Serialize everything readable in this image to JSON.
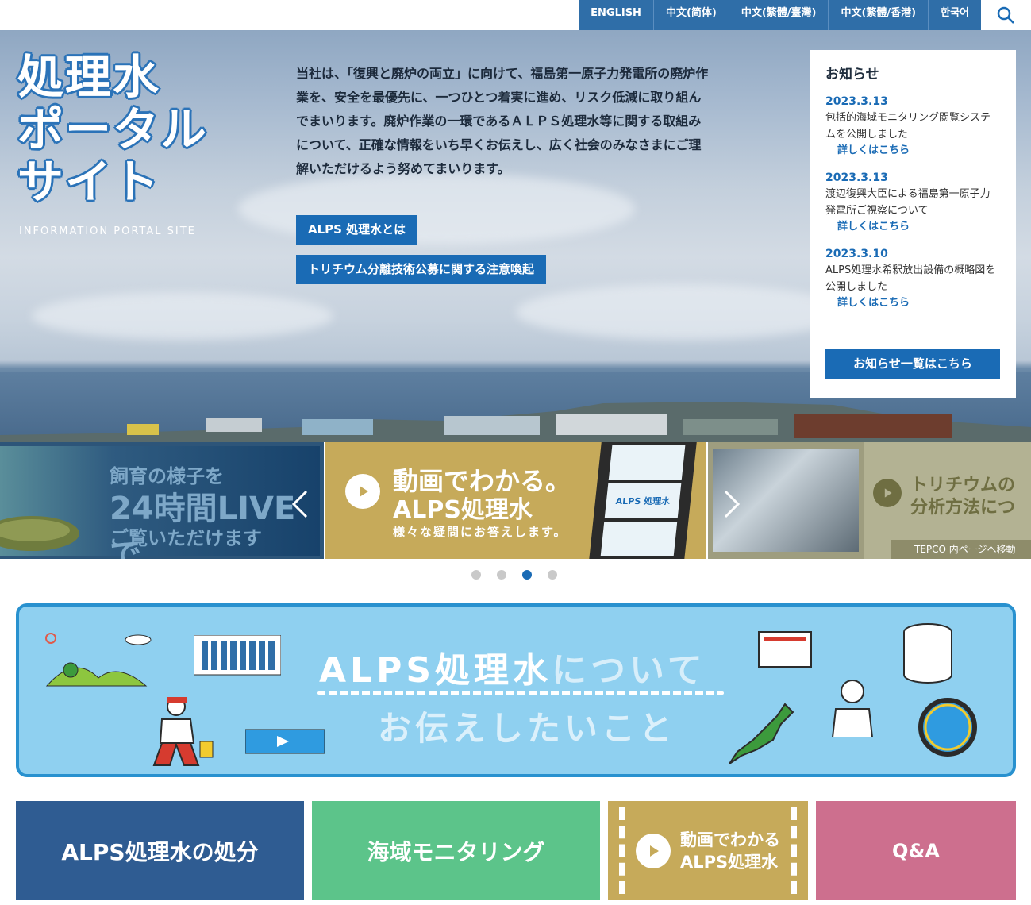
{
  "languages": [
    "ENGLISH",
    "中文(简体)",
    "中文(繁體/臺灣)",
    "中文(繁體/香港)",
    "한국어"
  ],
  "hero": {
    "title_lines": [
      "処理水",
      "ポータル",
      "サイト"
    ],
    "subtitle": "INFORMATION PORTAL SITE",
    "intro": "当社は、「復興と廃炉の両立」に向けて、福島第一原子力発電所の廃炉作業を、安全を最優先に、一つひとつ着実に進め、リスク低減に取り組んでまいります。廃炉作業の一環であるＡＬＰＳ処理水等に関する取組みについて、正確な情報をいち早くお伝えし、広く社会のみなさまにご理解いただけるよう努めてまいります。",
    "button1": "ALPS 処理水とは",
    "button2": "トリチウム分離技術公募に関する注意喚起"
  },
  "news": {
    "heading": "お知らせ",
    "items": [
      {
        "date": "2023.3.13",
        "text": "包括的海域モニタリング閲覧システムを公開しました",
        "more": "詳しくはこちら"
      },
      {
        "date": "2023.3.13",
        "text": "渡辺復興大臣による福島第一原子力発電所ご視察について",
        "more": "詳しくはこちら"
      },
      {
        "date": "2023.3.10",
        "text": "ALPS処理水希釈放出設備の概略図を公開しました",
        "more": "詳しくはこちら"
      }
    ],
    "all_button": "お知らせ一覧はこちら"
  },
  "carousel": {
    "slide_live": {
      "line1": "飼育の様子を",
      "line2": "24時間LIVEで",
      "line3": "ご覧いただけます"
    },
    "slide_video": {
      "line1": "動画でわかる。",
      "line2": "ALPS処理水",
      "line3": "様々な疑問にお答えします。",
      "film_label": "ALPS 処理水"
    },
    "slide_tritium": {
      "line1": "トリチウムの",
      "line2": "分析方法につ",
      "footer": "TEPCO 内ページへ移動"
    },
    "active_index": 2,
    "dot_count": 4
  },
  "banner": {
    "line1_main": "ALPS処理水",
    "line1_rest": "について",
    "line2": "お伝えしたいこと"
  },
  "tiles": {
    "disposal": "ALPS処理水の処分",
    "monitoring": "海域モニタリング",
    "video_line1": "動画でわかる",
    "video_line2": "ALPS処理水",
    "qa": "Q&A"
  },
  "colors": {
    "brand_blue": "#1a6bb5",
    "lang_bar": "#2f6ea8",
    "tile_disposal": "#2f5c92",
    "tile_monitoring": "#5cc48a",
    "tile_video": "#c6aa5a",
    "tile_qa": "#cd6f8e",
    "banner_bg": "#8fd0f0"
  }
}
